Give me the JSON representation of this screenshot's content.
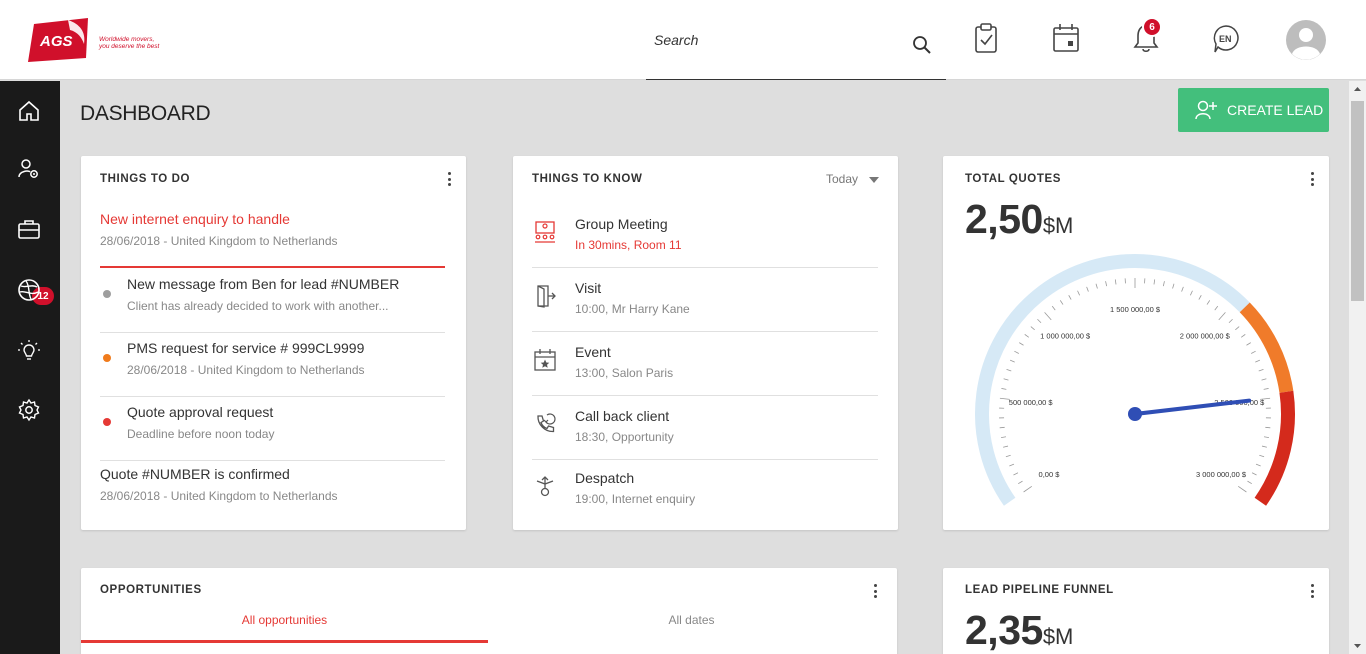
{
  "header": {
    "brand": "AGS",
    "tagline_line1": "Worldwide movers,",
    "tagline_line2": "you deserve the best",
    "search_placeholder": "Search",
    "notification_count": "6",
    "language": "EN",
    "icons": [
      "search-icon",
      "clipboard-check-icon",
      "calendar-icon",
      "bell-icon",
      "language-icon",
      "avatar-icon"
    ]
  },
  "sidebar": {
    "items": [
      {
        "name": "home-icon"
      },
      {
        "name": "user-settings-icon"
      },
      {
        "name": "briefcase-icon",
        "badge": "12"
      },
      {
        "name": "globe-icon"
      },
      {
        "name": "lightbulb-icon"
      },
      {
        "name": "gear-icon"
      }
    ]
  },
  "page": {
    "title": "DASHBOARD",
    "create_lead": "CREATE LEAD"
  },
  "things_to_do": {
    "title": "THINGS TO DO",
    "items": [
      {
        "title": "New internet enquiry to handle",
        "sub": "28/06/2018 - United Kingdom to Netherlands",
        "dot": null
      },
      {
        "title": "New message from Ben for lead #NUMBER",
        "sub": "Client has already decided to work with another...",
        "dot": "#9e9e9e"
      },
      {
        "title": "PMS request for service # 999CL9999",
        "sub": "28/06/2018 - United Kingdom to Netherlands",
        "dot": "#f07b1c"
      },
      {
        "title": "Quote approval request",
        "sub": "Deadline before noon today",
        "dot": "#e53935"
      },
      {
        "title": "Quote #NUMBER is confirmed",
        "sub": "28/06/2018 - United Kingdom to Netherlands",
        "dot": null
      }
    ]
  },
  "things_to_know": {
    "title": "THINGS TO KNOW",
    "filter": "Today",
    "items": [
      {
        "title": "Group Meeting",
        "sub": "In 30mins, Room 11",
        "icon": "group-meeting-icon"
      },
      {
        "title": "Visit",
        "sub": "10:00, Mr Harry Kane",
        "icon": "door-exit-icon"
      },
      {
        "title": "Event",
        "sub": "13:00, Salon Paris",
        "icon": "calendar-star-icon"
      },
      {
        "title": "Call back client",
        "sub": "18:30, Opportunity",
        "icon": "phone-callback-icon"
      },
      {
        "title": "Despatch",
        "sub": "19:00, Internet enquiry",
        "icon": "despatch-icon"
      }
    ]
  },
  "total_quotes": {
    "title": "TOTAL QUOTES",
    "value": "2,50",
    "unit": "$M",
    "gauge": {
      "min": 0,
      "max": 3000000,
      "value": 2500000,
      "labels": [
        "0,00 $",
        "500 000,00 $",
        "1 000 000,00 $",
        "1 500 000,00 $",
        "2 000 000,00 $",
        "2 500 000,00 $",
        "3 000 000,00 $"
      ],
      "colors": {
        "base": "#d6e9f6",
        "warn": "#f07b2a",
        "danger": "#d42a1c",
        "needle": "#2f4eb5"
      }
    }
  },
  "opportunities": {
    "title": "OPPORTUNITIES",
    "tabs": [
      "All opportunities",
      "All dates"
    ]
  },
  "lead_pipeline": {
    "title": "LEAD PIPELINE FUNNEL",
    "value": "2,35",
    "unit": "$M"
  },
  "colors": {
    "accent_red": "#e53935",
    "green": "#43bf7c",
    "sidebar": "#1a1a1a"
  }
}
